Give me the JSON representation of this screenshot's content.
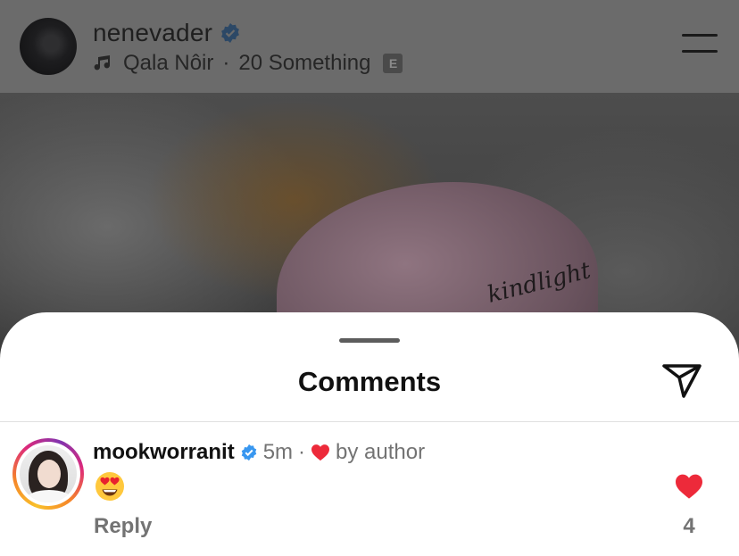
{
  "post": {
    "username": "nenevader",
    "music_artist": "Qala Nôir",
    "music_separator": "·",
    "music_title": "20 Something",
    "explicit_badge": "E",
    "cap_text": "kindlight"
  },
  "sheet": {
    "title": "Comments"
  },
  "comment": {
    "username": "mookworranit",
    "time": "5m",
    "separator": "·",
    "liked_by": "by author",
    "body_emoji": "heart-eyes-emoji",
    "reply_label": "Reply",
    "like_count": "4"
  },
  "colors": {
    "verified_blue": "#3897f0",
    "heart_red": "#ed2a3a",
    "muted_text": "#737373"
  }
}
